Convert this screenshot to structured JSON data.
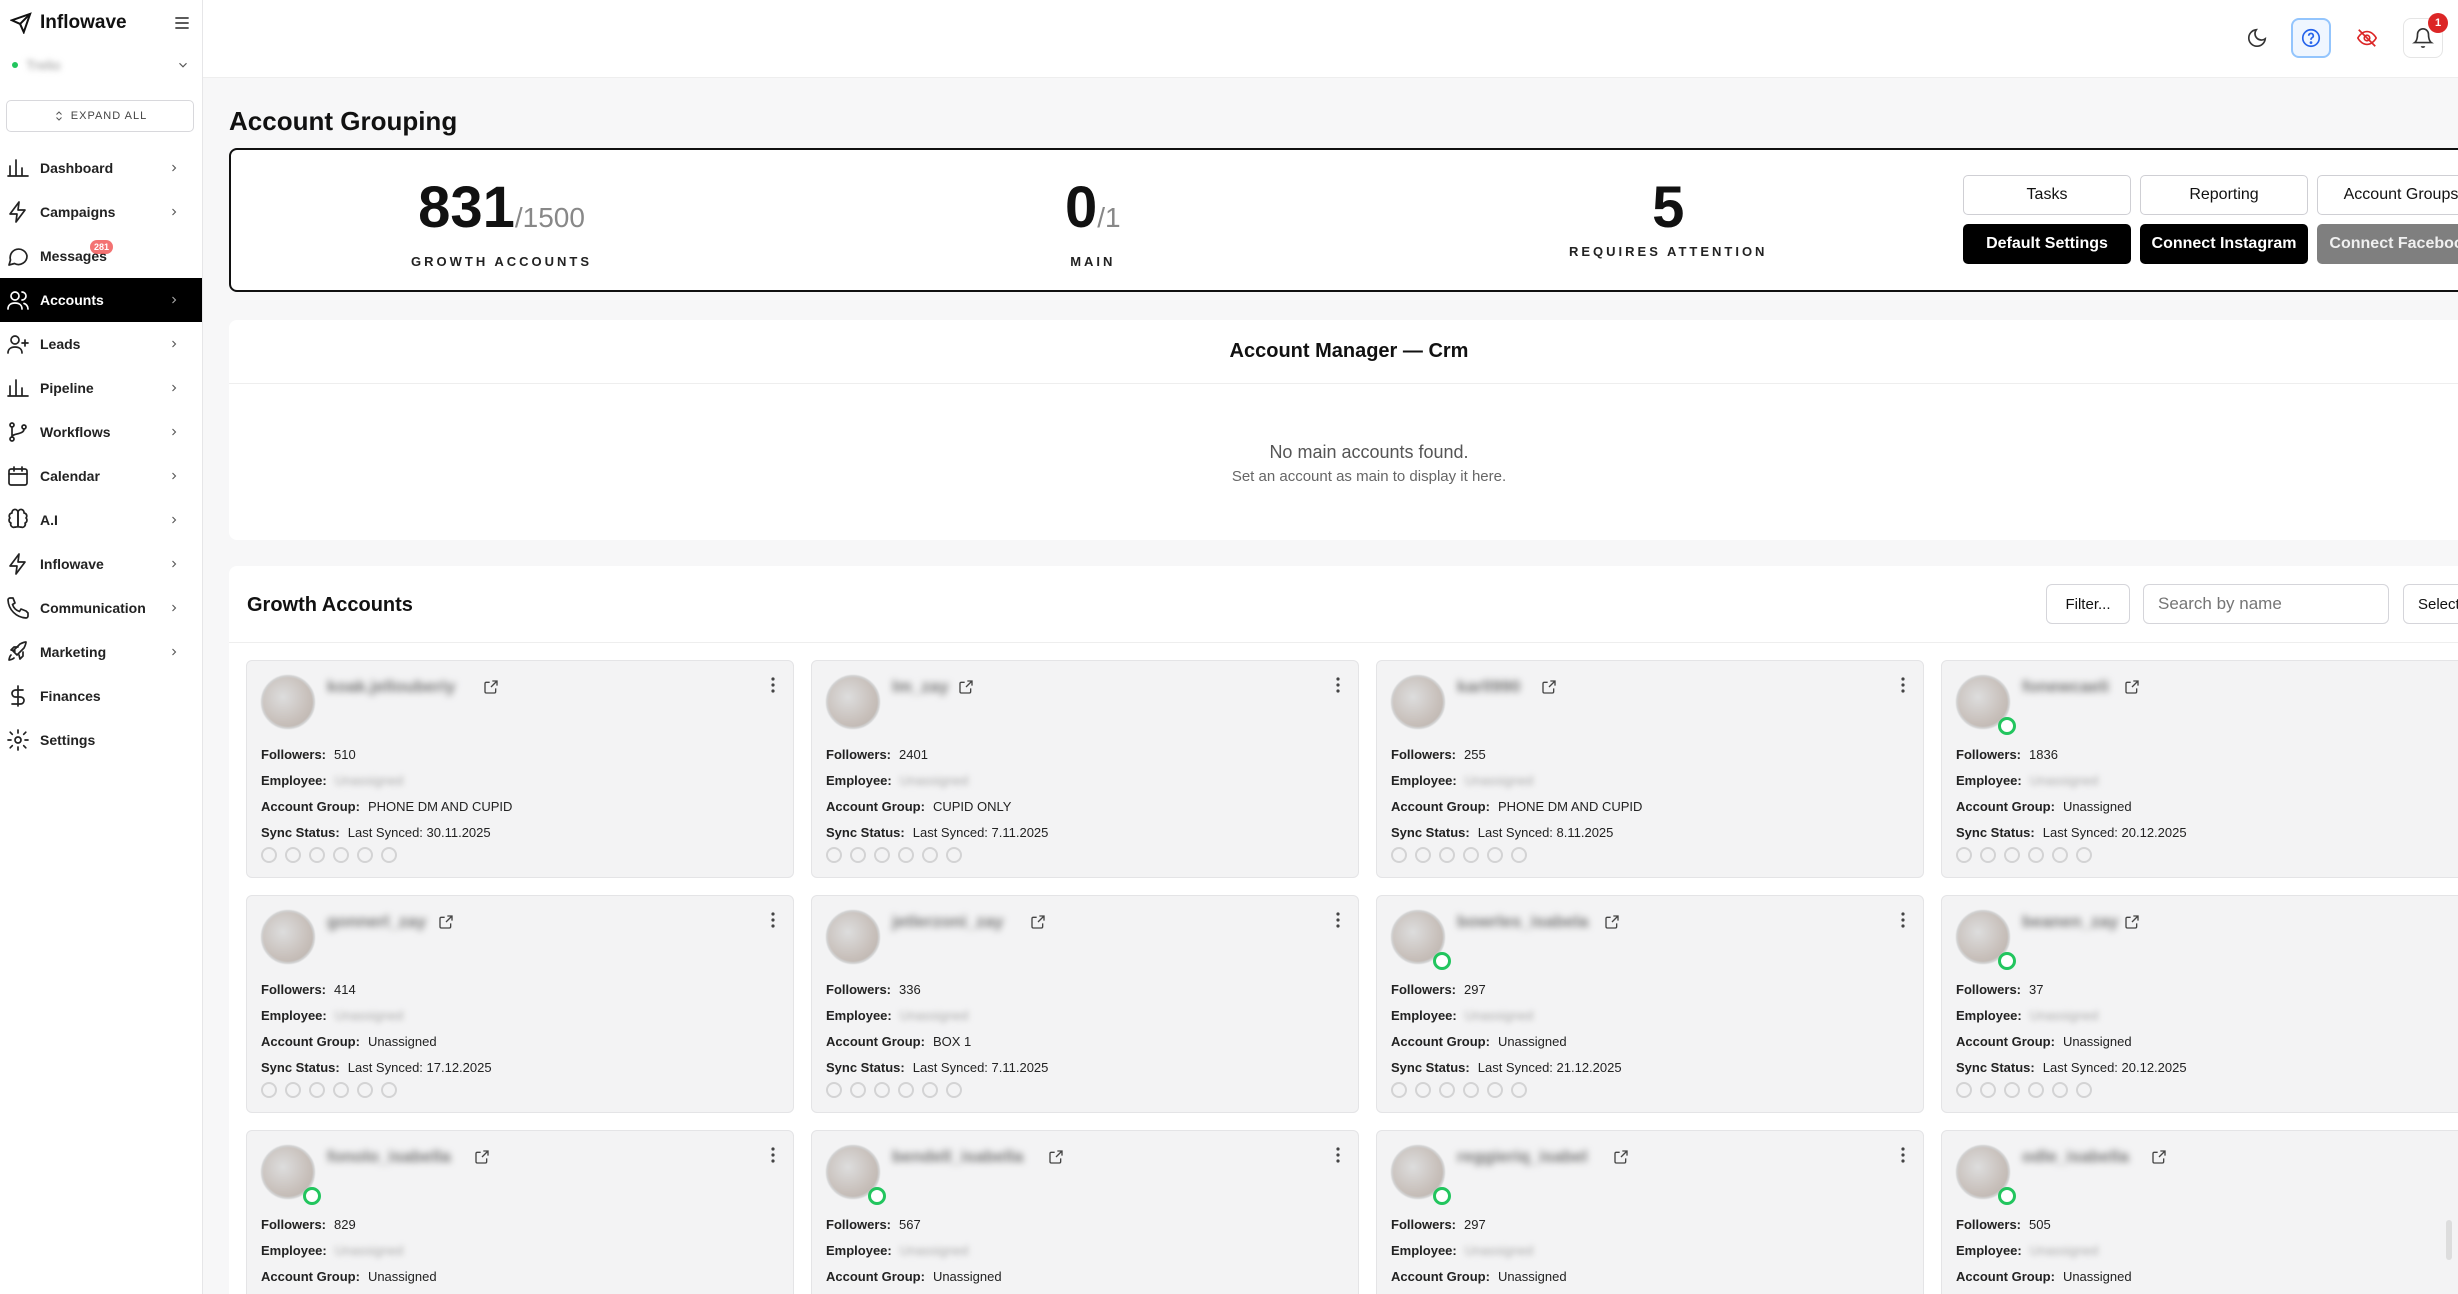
{
  "brand": {
    "name": "Inflowave"
  },
  "workspace": {
    "name": "Trelio"
  },
  "sidebar": {
    "expand_label": "EXPAND ALL",
    "items": [
      {
        "label": "Dashboard",
        "icon": "bar-chart-icon",
        "chevron": true
      },
      {
        "label": "Campaigns",
        "icon": "bolt-icon",
        "chevron": true
      },
      {
        "label": "Messages",
        "icon": "chat-icon",
        "chevron": false,
        "badge": "281"
      },
      {
        "label": "Accounts",
        "icon": "users-icon",
        "chevron": true,
        "active": true
      },
      {
        "label": "Leads",
        "icon": "user-plus-icon",
        "chevron": true
      },
      {
        "label": "Pipeline",
        "icon": "bar-chart-icon",
        "chevron": true
      },
      {
        "label": "Workflows",
        "icon": "git-branch-icon",
        "chevron": true
      },
      {
        "label": "Calendar",
        "icon": "calendar-icon",
        "chevron": true
      },
      {
        "label": "A.I",
        "icon": "brain-icon",
        "chevron": true
      },
      {
        "label": "Inflowave",
        "icon": "bolt-icon",
        "chevron": true
      },
      {
        "label": "Communication",
        "icon": "phone-icon",
        "chevron": true
      },
      {
        "label": "Marketing",
        "icon": "rocket-icon",
        "chevron": true
      },
      {
        "label": "Finances",
        "icon": "dollar-icon",
        "chevron": false
      },
      {
        "label": "Settings",
        "icon": "gear-icon",
        "chevron": false
      }
    ]
  },
  "topbar": {
    "notification_count": "1"
  },
  "page": {
    "title": "Account Grouping"
  },
  "stats": {
    "growth": {
      "value": "831",
      "of": "/1500",
      "label": "GROWTH ACCOUNTS"
    },
    "main": {
      "value": "0",
      "of": "/1",
      "label": "MAIN"
    },
    "attention": {
      "value": "5",
      "label": "REQUIRES ATTENTION"
    }
  },
  "actions": {
    "tasks": "Tasks",
    "reporting": "Reporting",
    "account_groups": "Account Groups",
    "default_settings": "Default Settings",
    "connect_instagram": "Connect Instagram",
    "connect_facebook": "Connect Facebook"
  },
  "manager": {
    "title": "Account Manager — Crm",
    "empty_title": "No main accounts found.",
    "empty_sub": "Set an account as main to display it here."
  },
  "growth": {
    "title": "Growth Accounts",
    "filter_label": "Filter...",
    "search_placeholder": "Search by name",
    "select_label": "Select",
    "labels": {
      "followers": "Followers:",
      "employee": "Employee:",
      "group": "Account Group:",
      "sync": "Sync Status:"
    },
    "cards": [
      {
        "username": "koak.jellouberiy",
        "followers": "510",
        "employee": "Unassigned",
        "group": "PHONE DM AND CUPID",
        "sync": "Last Synced: 30.11.2025",
        "online": false
      },
      {
        "username": "lm_zay",
        "followers": "2401",
        "employee": "Unassigned",
        "group": "CUPID ONLY",
        "sync": "Last Synced: 7.11.2025",
        "online": false
      },
      {
        "username": "karll990",
        "followers": "255",
        "employee": "Unassigned",
        "group": "PHONE DM AND CUPID",
        "sync": "Last Synced: 8.11.2025",
        "online": false
      },
      {
        "username": "fonewcaeli",
        "followers": "1836",
        "employee": "Unassigned",
        "group": "Unassigned",
        "sync": "Last Synced: 20.12.2025",
        "online": true
      },
      {
        "username": "gonnerl_zay",
        "followers": "414",
        "employee": "Unassigned",
        "group": "Unassigned",
        "sync": "Last Synced: 17.12.2025",
        "online": false
      },
      {
        "username": "jetlerzoni_zay",
        "followers": "336",
        "employee": "Unassigned",
        "group": "BOX 1",
        "sync": "Last Synced: 7.11.2025",
        "online": false
      },
      {
        "username": "bowrles_isabela",
        "followers": "297",
        "employee": "Unassigned",
        "group": "Unassigned",
        "sync": "Last Synced: 21.12.2025",
        "online": true
      },
      {
        "username": "beanen_zay",
        "followers": "37",
        "employee": "Unassigned",
        "group": "Unassigned",
        "sync": "Last Synced: 20.12.2025",
        "online": true
      },
      {
        "username": "fonolo_isabella",
        "followers": "829",
        "employee": "Unassigned",
        "group": "Unassigned",
        "sync": "",
        "online": true
      },
      {
        "username": "bendell_isabella",
        "followers": "567",
        "employee": "Unassigned",
        "group": "Unassigned",
        "sync": "",
        "online": true
      },
      {
        "username": "reggieriq_isabel",
        "followers": "297",
        "employee": "Unassigned",
        "group": "Unassigned",
        "sync": "",
        "online": true
      },
      {
        "username": "odle_isabella",
        "followers": "505",
        "employee": "Unassigned",
        "group": "Unassigned",
        "sync": "",
        "online": true
      }
    ]
  }
}
